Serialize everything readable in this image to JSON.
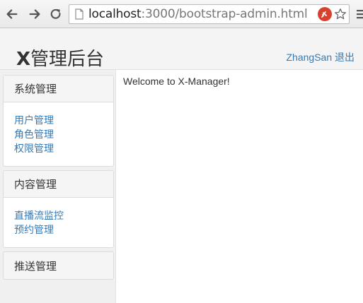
{
  "browser": {
    "url_host": "localhost",
    "url_rest": ":3000/bootstrap-admin.html"
  },
  "header": {
    "brand_x": "X",
    "brand_rest": "管理后台",
    "username": "ZhangSan",
    "logout": "退出"
  },
  "sidebar": {
    "panels": [
      {
        "title": "系统管理",
        "items": [
          "用户管理",
          "角色管理",
          "权限管理"
        ]
      },
      {
        "title": "内容管理",
        "items": [
          "直播流监控",
          "预约管理"
        ]
      },
      {
        "title": "推送管理",
        "items": []
      }
    ]
  },
  "main": {
    "welcome": "Welcome to X-Manager!"
  },
  "colors": {
    "link": "#337ab7",
    "extension": "#d9412f"
  }
}
